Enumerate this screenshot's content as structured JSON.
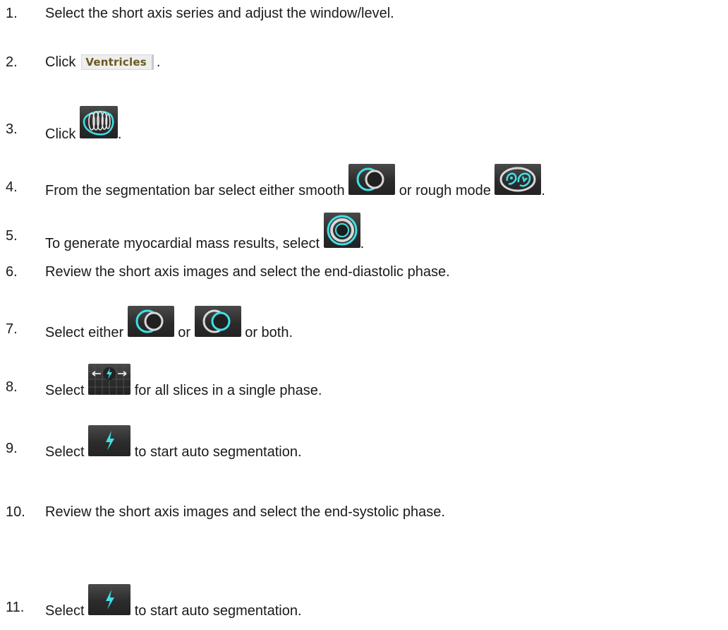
{
  "steps": [
    {
      "num": "1.",
      "text": "Select the short axis series and adjust the window/level."
    },
    {
      "num": "2.",
      "text_before": "Click",
      "button_label": "Ventricles",
      "text_after": "."
    },
    {
      "num": "3.",
      "text_before": "Click",
      "text_after": ".",
      "icon": "lv-stack-icon"
    },
    {
      "num": "4.",
      "text_before": "From the segmentation bar select either smooth",
      "text_middle": "or rough mode",
      "text_after": ".",
      "icons": [
        "smooth-mode-icon",
        "rough-mode-icon"
      ]
    },
    {
      "num": "5.",
      "text_before": "To generate myocardial mass results, select",
      "text_after": ".",
      "icon": "myocardial-mass-icon"
    },
    {
      "num": "6.",
      "text": "Review the short axis images and select the end-diastolic phase."
    },
    {
      "num": "7.",
      "text_before": "Select either",
      "text_middle": "or",
      "text_after": "or both.",
      "icons": [
        "lv-contour-icon",
        "rv-contour-icon"
      ]
    },
    {
      "num": "8.",
      "text_before": "Select",
      "text_after": "for all slices in a single phase.",
      "icon": "all-slices-single-phase-icon"
    },
    {
      "num": "9.",
      "text_before": "Select",
      "text_after": "to start auto segmentation.",
      "icon": "auto-segment-icon"
    },
    {
      "num": "10.",
      "text": "Review the short axis images and select the end-systolic phase."
    },
    {
      "num": "11.",
      "text_before": "Select",
      "text_after": "to start auto segmentation.",
      "icon": "auto-segment-icon"
    }
  ],
  "colors": {
    "accent": "#3fe0e6",
    "button_dark": "#2c2c2c",
    "ventricles_text": "#6b5a1e"
  }
}
